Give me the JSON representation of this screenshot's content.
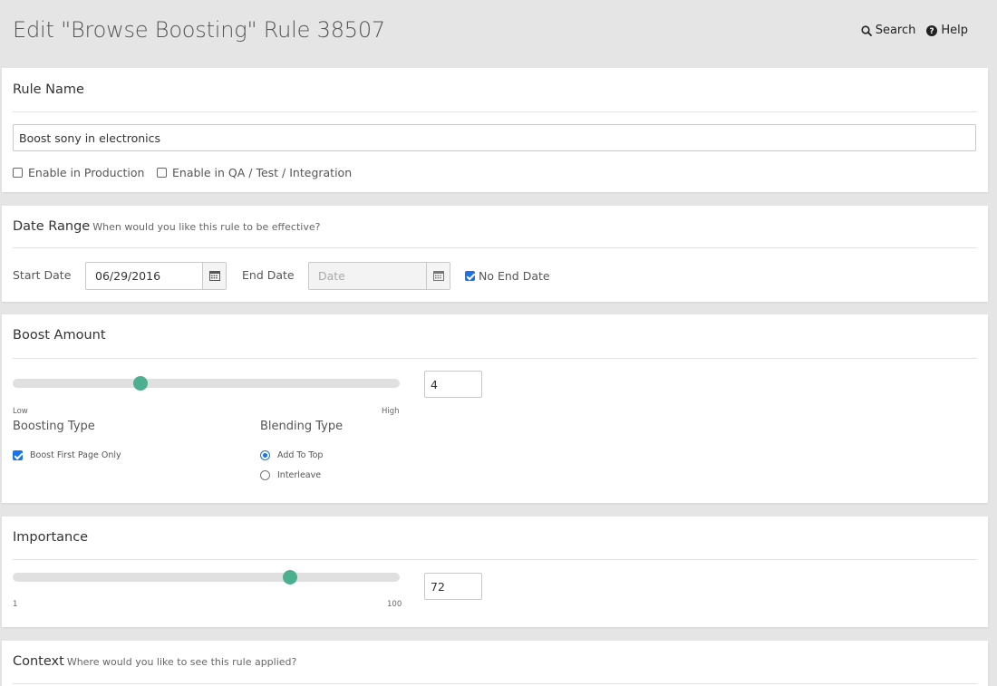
{
  "header": {
    "title": "Edit \"Browse Boosting\" Rule 38507",
    "search_label": "Search",
    "help_label": "Help"
  },
  "rule_name": {
    "title": "Rule Name",
    "value": "Boost sony in electronics",
    "enable_production_label": "Enable in Production",
    "enable_production_checked": false,
    "enable_qa_label": "Enable in QA / Test / Integration",
    "enable_qa_checked": false
  },
  "date_range": {
    "title": "Date Range",
    "subtitle": "When would you like this rule to be effective?",
    "start_label": "Start Date",
    "start_value": "06/29/2016",
    "end_label": "End Date",
    "end_placeholder": "Date",
    "no_end_label": "No End Date",
    "no_end_checked": true
  },
  "boost_amount": {
    "title": "Boost Amount",
    "value": "4",
    "slider_fraction": 0.33,
    "low_label": "Low",
    "high_label": "High",
    "boosting_type_label": "Boosting Type",
    "boost_first_page_label": "Boost First Page Only",
    "boost_first_page_checked": true,
    "blending_type_label": "Blending Type",
    "blending_options": [
      {
        "label": "Add To Top",
        "selected": true
      },
      {
        "label": "Interleave",
        "selected": false
      }
    ]
  },
  "importance": {
    "title": "Importance",
    "value": "72",
    "slider_fraction": 0.717,
    "min_label": "1",
    "max_label": "100"
  },
  "context": {
    "title": "Context",
    "subtitle": "Where would you like to see this rule applied?"
  },
  "colors": {
    "accent": "#1a73e8",
    "slider_thumb": "#4caf8f",
    "background": "#e5e5e5"
  },
  "icons": {
    "search": "search-icon",
    "help": "question-circle-icon",
    "calendar": "calendar-icon"
  }
}
